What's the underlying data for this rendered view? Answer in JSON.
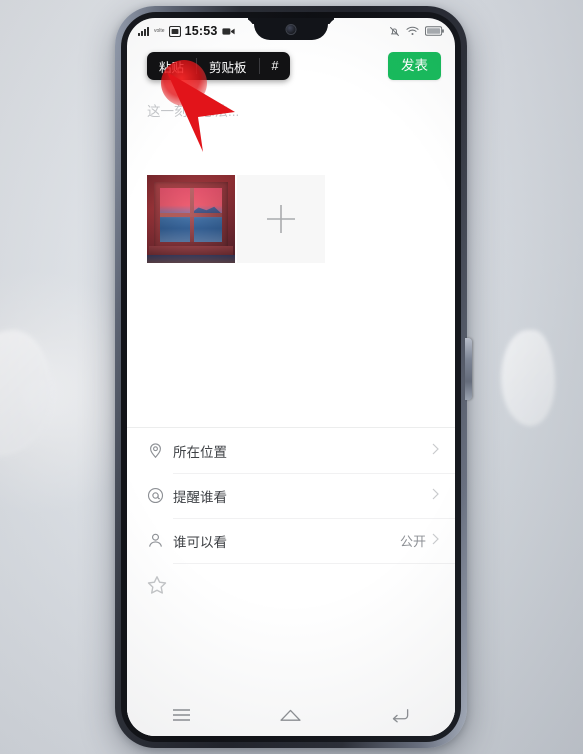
{
  "status_bar": {
    "time": "15:53",
    "carrier_label": "volte",
    "icons_left": [
      "signal-bars-icon",
      "sim-card-icon",
      "video-recording-icon"
    ],
    "icons_right": [
      "mute-bell-icon",
      "wifi-icon",
      "battery-icon"
    ]
  },
  "header": {
    "publish_label": "发表"
  },
  "context_menu": {
    "items": [
      {
        "label": "粘贴",
        "name": "paste"
      },
      {
        "label": "剪贴板",
        "name": "clipboard"
      },
      {
        "label": "#",
        "name": "hashtag"
      }
    ]
  },
  "compose": {
    "placeholder": "这一刻的想法...",
    "value": "",
    "media": {
      "thumbnail_alt": "window-sunset-painting",
      "add_icon": "plus-icon"
    }
  },
  "options": [
    {
      "icon": "location-pin-icon",
      "label": "所在位置",
      "value": "",
      "chevron": "›"
    },
    {
      "icon": "at-mention-icon",
      "label": "提醒谁看",
      "value": "",
      "chevron": "›"
    },
    {
      "icon": "person-icon",
      "label": "谁可以看",
      "value": "公开",
      "chevron": "›"
    }
  ],
  "extra_row": {
    "icon": "star-outline-icon"
  },
  "nav_bar": {
    "buttons": [
      {
        "name": "menu-button",
        "icon": "hamburger-menu-icon"
      },
      {
        "name": "home-button",
        "icon": "home-icon"
      },
      {
        "name": "back-button",
        "icon": "back-arrow-icon"
      }
    ]
  },
  "annotation": {
    "tap_color": "#e21216",
    "arrow_color": "#e2141a",
    "target": "粘贴"
  },
  "colors": {
    "accent_green": "#18bb5c",
    "menu_background": "#121214",
    "screen_background": "#ffffff",
    "text_primary": "#3f4246",
    "text_secondary": "#8d9095",
    "placeholder": "#c4c6c9"
  }
}
